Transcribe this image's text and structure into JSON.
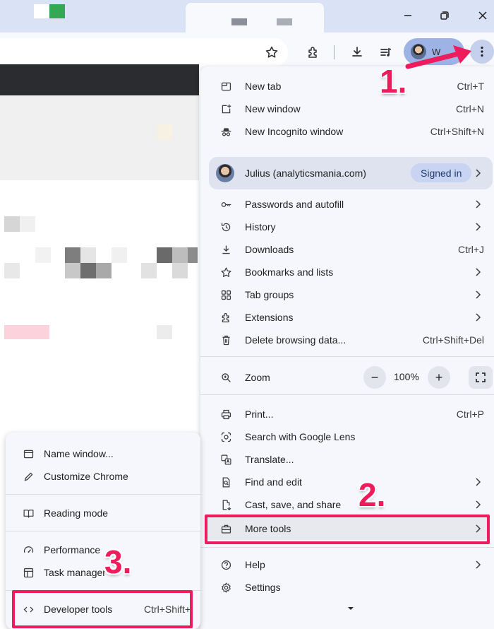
{
  "colors": {
    "accent_annotation": "#ee1c5c",
    "menu_bg": "#f6f7fc",
    "titlebar": "#dae2f6"
  },
  "toolbar": {
    "profile_initial": "W"
  },
  "menu": {
    "items_top": [
      {
        "label": "New tab",
        "shortcut": "Ctrl+T",
        "icon": "new-tab-icon"
      },
      {
        "label": "New window",
        "shortcut": "Ctrl+N",
        "icon": "new-window-icon"
      },
      {
        "label": "New Incognito window",
        "shortcut": "Ctrl+Shift+N",
        "icon": "incognito-icon"
      }
    ],
    "profile": {
      "name": "Julius (analyticsmania.com)",
      "status": "Signed in"
    },
    "items_mid": [
      {
        "label": "Passwords and autofill",
        "icon": "key-icon"
      },
      {
        "label": "History",
        "icon": "history-icon"
      },
      {
        "label": "Downloads",
        "shortcut": "Ctrl+J",
        "icon": "download-icon"
      },
      {
        "label": "Bookmarks and lists",
        "icon": "star-icon"
      },
      {
        "label": "Tab groups",
        "icon": "tab-groups-icon"
      },
      {
        "label": "Extensions",
        "icon": "puzzle-icon"
      },
      {
        "label": "Delete browsing data...",
        "shortcut": "Ctrl+Shift+Del",
        "icon": "trash-icon"
      }
    ],
    "zoom": {
      "label": "Zoom",
      "value": "100%",
      "minus": "−",
      "plus": "+"
    },
    "items_low": [
      {
        "label": "Print...",
        "shortcut": "Ctrl+P",
        "icon": "print-icon"
      },
      {
        "label": "Search with Google Lens",
        "icon": "lens-icon"
      },
      {
        "label": "Translate...",
        "icon": "translate-icon"
      },
      {
        "label": "Find and edit",
        "icon": "find-icon"
      },
      {
        "label": "Cast, save, and share",
        "icon": "cast-icon"
      },
      {
        "label": "More tools",
        "icon": "toolbox-icon"
      }
    ],
    "items_bottom": [
      {
        "label": "Help",
        "icon": "help-icon"
      },
      {
        "label": "Settings",
        "icon": "settings-icon"
      }
    ]
  },
  "submenu": {
    "items": [
      {
        "label": "Name window...",
        "icon": "window-icon"
      },
      {
        "label": "Customize Chrome",
        "icon": "pencil-icon"
      },
      {
        "label": "Reading mode",
        "icon": "book-icon"
      },
      {
        "label": "Performance",
        "icon": "gauge-icon"
      },
      {
        "label": "Task manager",
        "icon": "task-manager-icon"
      },
      {
        "label": "Developer tools",
        "shortcut": "Ctrl+Shift+I",
        "icon": "code-icon"
      }
    ]
  },
  "annotations": {
    "step1": "1.",
    "step2": "2.",
    "step3": "3."
  }
}
